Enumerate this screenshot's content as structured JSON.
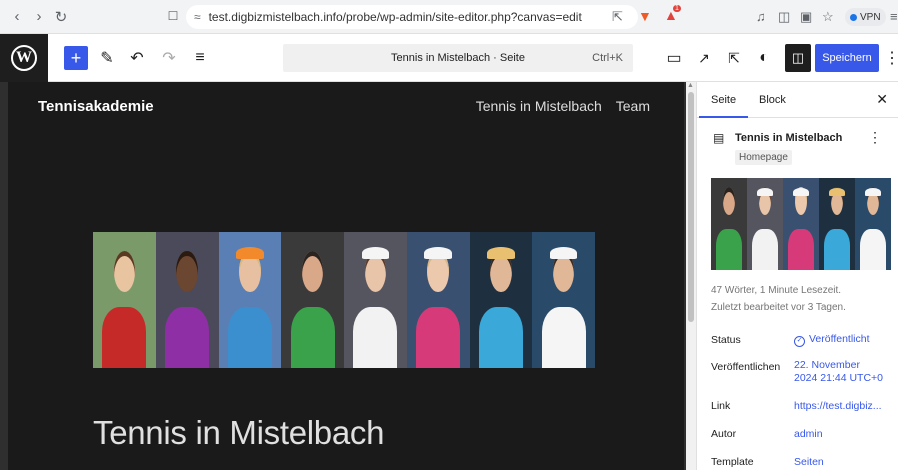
{
  "browser": {
    "url": "test.digbizmistelbach.info/probe/wp-admin/site-editor.php?canvas=edit",
    "vpn_label": "VPN",
    "notification_count": "1"
  },
  "toolbar": {
    "doc_title": "Tennis in Mistelbach · Seite",
    "shortcut": "Ctrl+K",
    "save_label": "Speichern"
  },
  "canvas": {
    "site_title": "Tennisakademie",
    "nav": [
      "Tennis in Mistelbach",
      "Team"
    ],
    "page_heading": "Tennis in Mistelbach",
    "hero_photos": [
      {
        "bg": "#7a9a6a",
        "skin": "#e8c4a0",
        "hair": "#5a3a22",
        "shirt": "#c62a28"
      },
      {
        "bg": "#4a4a5a",
        "skin": "#6b4630",
        "hair": "#2a1a10",
        "shirt": "#8e2fa6"
      },
      {
        "bg": "#5a7fb5",
        "skin": "#e6c0a0",
        "hair": "#d9b880",
        "shirt": "#3c8fcf",
        "cap": "#f28a2c"
      },
      {
        "bg": "#3a3a3a",
        "skin": "#d8a888",
        "hair": "#2a2420",
        "shirt": "#3aa24a"
      },
      {
        "bg": "#555560",
        "skin": "#e8c4a8",
        "hair": "#5a3a28",
        "shirt": "#f2f2f2",
        "cap": "#f5f5f5"
      },
      {
        "bg": "#3a5070",
        "skin": "#ecc8ac",
        "hair": "#d8b888",
        "shirt": "#d63a78",
        "cap": "#f5f5f5"
      },
      {
        "bg": "#1e3040",
        "skin": "#e0b898",
        "hair": "#3a2a20",
        "shirt": "#3aa8d8",
        "cap": "#e8c070"
      },
      {
        "bg": "#2a4a6a",
        "skin": "#e0b898",
        "hair": "#3a2a20",
        "shirt": "#f5f5f5",
        "cap": "#f5f5f5"
      }
    ]
  },
  "sidebar": {
    "tab_page": "Seite",
    "tab_block": "Block",
    "page_title": "Tennis in Mistelbach",
    "badge": "Homepage",
    "stats": "47 Wörter, 1 Minute Lesezeit.",
    "last_edited": "Zuletzt bearbeitet vor 3 Tagen.",
    "rows": {
      "status_label": "Status",
      "status_value": "Veröffentlicht",
      "published_label": "Veröffentlichen",
      "published_value_1": "22. November",
      "published_value_2": "2024 21:44 UTC+0",
      "link_label": "Link",
      "link_value": "https://test.digbiz...",
      "author_label": "Autor",
      "author_value": "admin",
      "template_label": "Template",
      "template_value": "Seiten"
    }
  }
}
